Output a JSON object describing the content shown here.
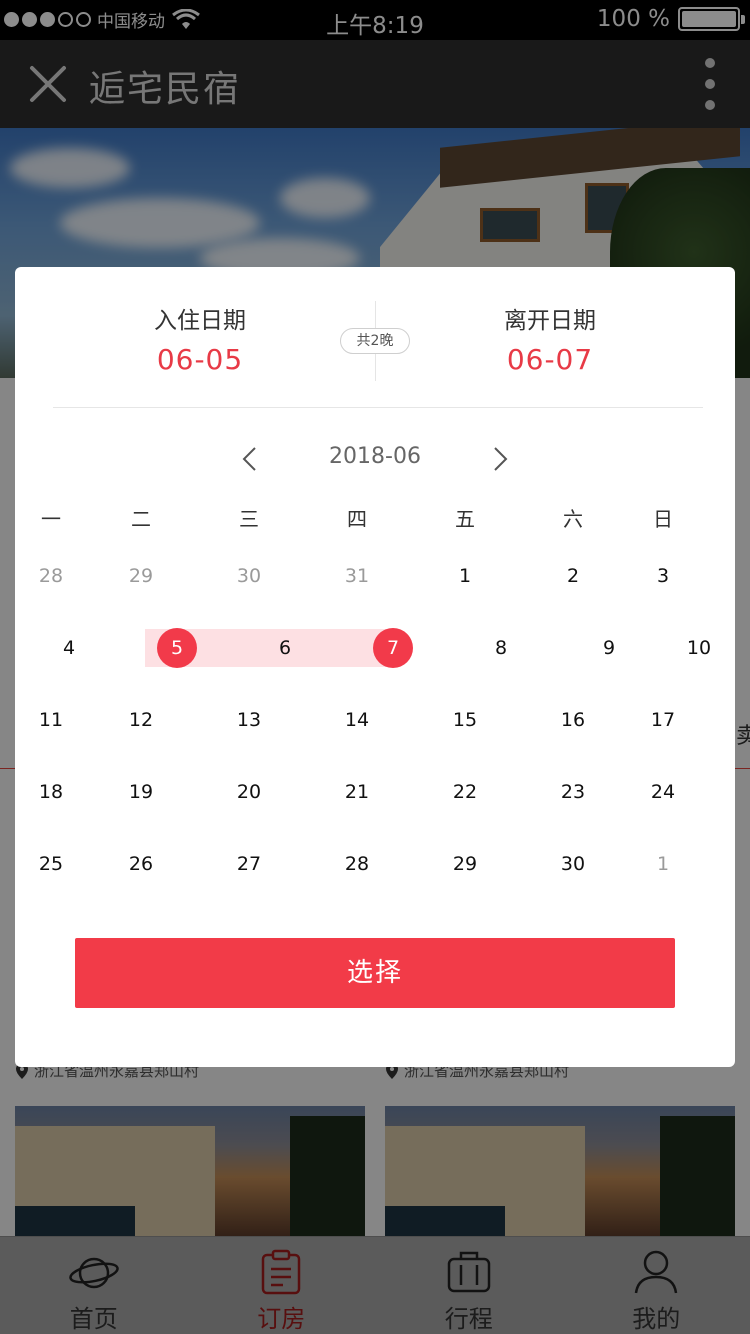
{
  "status_bar": {
    "carrier": "中国移动",
    "time": "上午8:19",
    "battery": "100 %",
    "signal_dots_filled": 3,
    "signal_dots_total": 5
  },
  "nav": {
    "title": "逅宅民宿",
    "close_icon": "close-icon",
    "more_icon": "more-vertical-icon"
  },
  "background": {
    "partial_char": "卖",
    "location_1": "浙江省温州永嘉县郑山村",
    "location_2": "浙江省温州永嘉县郑山村"
  },
  "date_picker": {
    "checkin_label": "入住日期",
    "checkin_value": "06-05",
    "checkout_label": "离开日期",
    "checkout_value": "06-07",
    "nights": "共2晚",
    "month": "2018-06",
    "prev_icon": "chevron-left-icon",
    "next_icon": "chevron-right-icon",
    "weekdays": [
      "一",
      "二",
      "三",
      "四",
      "五",
      "六",
      "日"
    ],
    "weeks": [
      [
        "28",
        "29",
        "30",
        "31",
        "1",
        "2",
        "3"
      ],
      [
        "4",
        "5",
        "6",
        "7",
        "8",
        "9",
        "10"
      ],
      [
        "11",
        "12",
        "13",
        "14",
        "15",
        "16",
        "17"
      ],
      [
        "18",
        "19",
        "20",
        "21",
        "22",
        "23",
        "24"
      ],
      [
        "25",
        "26",
        "27",
        "28",
        "29",
        "30",
        "1"
      ]
    ],
    "muted_cells": [
      [
        0,
        0
      ],
      [
        0,
        1
      ],
      [
        0,
        2
      ],
      [
        0,
        3
      ],
      [
        4,
        6
      ]
    ],
    "selected_cells": [
      [
        1,
        1
      ],
      [
        1,
        3
      ]
    ],
    "range_cells": [
      [
        1,
        2
      ]
    ],
    "select_label": "选择"
  },
  "colors": {
    "accent": "#f23a4a",
    "range_fill": "#fde0e3",
    "date_value": "#e83a46",
    "active_tab": "#a11d1d"
  },
  "tabbar": {
    "items": [
      {
        "label": "首页",
        "icon": "planet-icon",
        "active": false
      },
      {
        "label": "订房",
        "icon": "clipboard-icon",
        "active": true
      },
      {
        "label": "行程",
        "icon": "luggage-icon",
        "active": false
      },
      {
        "label": "我的",
        "icon": "user-icon",
        "active": false
      }
    ]
  }
}
